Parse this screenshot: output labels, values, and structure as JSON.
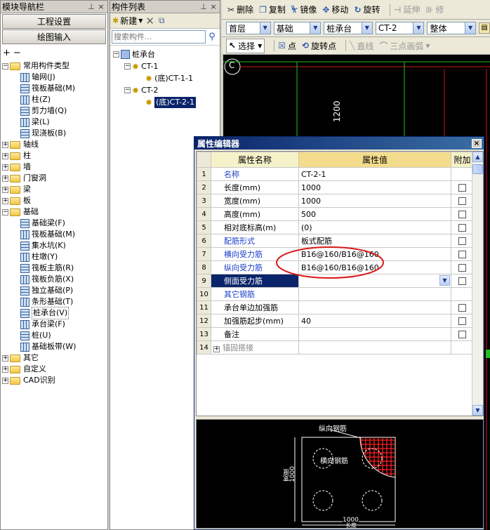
{
  "nav_panel": {
    "title": "模块导航栏",
    "project_settings_label": "工程设置",
    "drawing_input_label": "绘图输入",
    "tree": [
      {
        "level": 0,
        "expanded": true,
        "type": "folder",
        "label": "常用构件类型"
      },
      {
        "level": 1,
        "type": "item",
        "label": "轴网(J)",
        "icon": "axis-grid-icon"
      },
      {
        "level": 1,
        "type": "item",
        "label": "筏板基础(M)",
        "icon": "raft-foundation-icon"
      },
      {
        "level": 1,
        "type": "item",
        "label": "柱(Z)",
        "icon": "column-icon"
      },
      {
        "level": 1,
        "type": "item",
        "label": "剪力墙(Q)",
        "icon": "shear-wall-icon"
      },
      {
        "level": 1,
        "type": "item",
        "label": "梁(L)",
        "icon": "beam-icon"
      },
      {
        "level": 1,
        "type": "item",
        "label": "现浇板(B)",
        "icon": "slab-icon"
      },
      {
        "level": 0,
        "expanded": false,
        "type": "folder",
        "label": "轴线"
      },
      {
        "level": 0,
        "expanded": false,
        "type": "folder",
        "label": "柱"
      },
      {
        "level": 0,
        "expanded": false,
        "type": "folder",
        "label": "墙"
      },
      {
        "level": 0,
        "expanded": false,
        "type": "folder",
        "label": "门窗洞"
      },
      {
        "level": 0,
        "expanded": false,
        "type": "folder",
        "label": "梁"
      },
      {
        "level": 0,
        "expanded": false,
        "type": "folder",
        "label": "板"
      },
      {
        "level": 0,
        "expanded": true,
        "type": "folder",
        "label": "基础"
      },
      {
        "level": 1,
        "type": "item",
        "label": "基础梁(F)",
        "icon": "foundation-beam-icon"
      },
      {
        "level": 1,
        "type": "item",
        "label": "筏板基础(M)",
        "icon": "raft-foundation-icon"
      },
      {
        "level": 1,
        "type": "item",
        "label": "集水坑(K)",
        "icon": "sump-pit-icon"
      },
      {
        "level": 1,
        "type": "item",
        "label": "柱墩(Y)",
        "icon": "column-pier-icon"
      },
      {
        "level": 1,
        "type": "item",
        "label": "筏板主筋(R)",
        "icon": "raft-main-rebar-icon"
      },
      {
        "level": 1,
        "type": "item",
        "label": "筏板负筋(X)",
        "icon": "raft-negative-rebar-icon"
      },
      {
        "level": 1,
        "type": "item",
        "label": "独立基础(P)",
        "icon": "isolated-footing-icon"
      },
      {
        "level": 1,
        "type": "item",
        "label": "条形基础(T)",
        "icon": "strip-footing-icon"
      },
      {
        "level": 1,
        "type": "item",
        "label": "桩承台(V)",
        "icon": "pile-cap-icon",
        "active": true
      },
      {
        "level": 1,
        "type": "item",
        "label": "承台梁(F)",
        "icon": "cap-beam-icon"
      },
      {
        "level": 1,
        "type": "item",
        "label": "桩(U)",
        "icon": "pile-icon"
      },
      {
        "level": 1,
        "type": "item",
        "label": "基础板带(W)",
        "icon": "foundation-strip-icon"
      },
      {
        "level": 0,
        "expanded": false,
        "type": "folder",
        "label": "其它"
      },
      {
        "level": 0,
        "expanded": false,
        "type": "folder",
        "label": "自定义"
      },
      {
        "level": 0,
        "expanded": false,
        "type": "folder",
        "label": "CAD识别"
      }
    ]
  },
  "component_panel": {
    "title": "构件列表",
    "new_label": "新建",
    "search_placeholder": "搜索构件...",
    "tree": [
      {
        "level": 0,
        "label": "桩承台",
        "icon": "pile-cap-icon"
      },
      {
        "level": 1,
        "label": "CT-1",
        "icon": "gear-icon"
      },
      {
        "level": 2,
        "label": "(底)CT-1-1",
        "icon": "gear-icon"
      },
      {
        "level": 1,
        "label": "CT-2",
        "icon": "gear-icon"
      },
      {
        "level": 2,
        "label": "(底)CT-2-1",
        "icon": "gear-icon",
        "selected": true
      }
    ]
  },
  "toolbar1": {
    "delete": "删除",
    "copy": "复制",
    "mirror": "镜像",
    "move": "移动",
    "rotate": "旋转",
    "extend": "延伸",
    "trim": "修"
  },
  "toolbar2": {
    "floor": "首层",
    "category": "基础",
    "type": "桩承台",
    "component": "CT-2",
    "scope": "整体"
  },
  "toolbar3": {
    "select": "选择",
    "point": "点",
    "rotate_point": "旋转点",
    "line": "直线",
    "arc": "三点画弧"
  },
  "cad": {
    "axis_label": "C",
    "dim_text": "1200"
  },
  "dialog": {
    "title": "属性编辑器",
    "col_name": "属性名称",
    "col_value": "属性值",
    "col_extra": "附加",
    "rows": [
      {
        "num": "1",
        "name": "名称",
        "value": "CT-2-1",
        "blue": true,
        "check": false
      },
      {
        "num": "2",
        "name": "长度(mm)",
        "value": "1000",
        "blue": false,
        "check": true
      },
      {
        "num": "3",
        "name": "宽度(mm)",
        "value": "1000",
        "blue": false,
        "check": true
      },
      {
        "num": "4",
        "name": "高度(mm)",
        "value": "500",
        "blue": false,
        "check": true
      },
      {
        "num": "5",
        "name": "相对底标高(m)",
        "value": "(0)",
        "blue": false,
        "check": true
      },
      {
        "num": "6",
        "name": "配筋形式",
        "value": "板式配筋",
        "blue": true,
        "check": true
      },
      {
        "num": "7",
        "name": "横向受力筋",
        "value": "B16@160/B16@160",
        "blue": true,
        "check": true
      },
      {
        "num": "8",
        "name": "纵向受力筋",
        "value": "B16@160/B16@160",
        "blue": true,
        "check": true
      },
      {
        "num": "9",
        "name": "侧面受力筋",
        "value": "",
        "blue": true,
        "check": true,
        "selected": true
      },
      {
        "num": "10",
        "name": "其它钢筋",
        "value": "",
        "blue": true,
        "check": false
      },
      {
        "num": "11",
        "name": "承台单边加强筋",
        "value": "",
        "blue": false,
        "check": true
      },
      {
        "num": "12",
        "name": "加强筋起步(mm)",
        "value": "40",
        "blue": false,
        "check": true
      },
      {
        "num": "13",
        "name": "备注",
        "value": "",
        "blue": false,
        "check": true
      },
      {
        "num": "14",
        "name": "锚固搭接",
        "value": "",
        "blue": false,
        "check": false,
        "expandable": true,
        "dim": true
      }
    ]
  },
  "preview": {
    "longitudinal_rebar": "纵向钢筋",
    "transverse_rebar": "横向钢筋",
    "width_dim": "1000",
    "width_label": "宽度",
    "length_dim": "1000",
    "length_label": "长度"
  },
  "colors": {
    "highlight_ellipse": "#d81818",
    "selection": "#0a246a",
    "cad_green": "#20c020",
    "cad_red": "#d01818",
    "rebar_mesh": "#ff2020"
  }
}
